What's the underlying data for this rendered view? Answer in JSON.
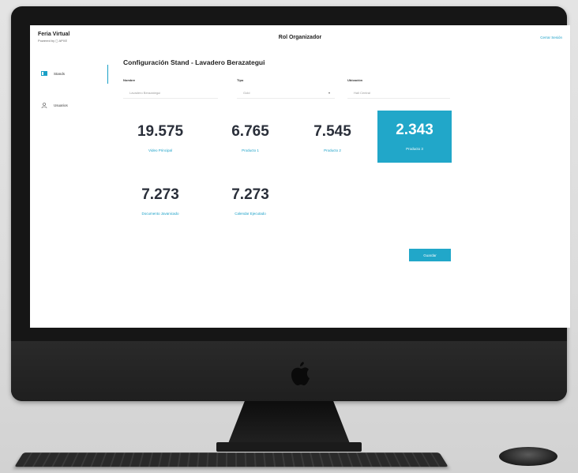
{
  "app": {
    "brand_name": "Feria Virtual",
    "brand_sub": "Powered by ◻ APXE",
    "role_title": "Rol Organizador",
    "logout_label": "Cerrar Sesión"
  },
  "sidebar": {
    "items": [
      {
        "label": "Stands",
        "icon": "stands-icon",
        "active": true
      },
      {
        "label": "Usuarios",
        "icon": "users-icon",
        "active": false
      }
    ]
  },
  "main": {
    "title": "Configuración Stand - Lavadero Berazategui",
    "fields": [
      {
        "label": "Nombre",
        "value": "Lavadero Berazategui"
      },
      {
        "label": "Tipo",
        "value": "Gold"
      },
      {
        "label": "Ubicación",
        "value": "Hall Central"
      }
    ],
    "cards": [
      {
        "value": "19.575",
        "label": "Video Principal",
        "active": false
      },
      {
        "value": "6.765",
        "label": "Producto 1",
        "active": false
      },
      {
        "value": "7.545",
        "label": "Producto 2",
        "active": false
      },
      {
        "value": "2.343",
        "label": "Producto 3",
        "active": true
      },
      {
        "value": "7.273",
        "label": "Documento Javanicado",
        "active": false
      },
      {
        "value": "7.273",
        "label": "Calendar Ejecutado",
        "active": false
      }
    ],
    "save_label": "Guardar"
  },
  "colors": {
    "accent": "#21a7c9",
    "link": "#1aa0c7",
    "text_dark": "#2a2f3a"
  }
}
